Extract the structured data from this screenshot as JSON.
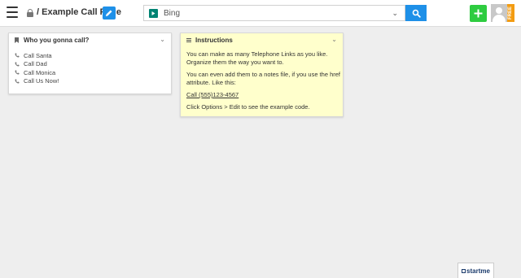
{
  "header": {
    "page_title": "/ Example Call Page",
    "search": {
      "engine_label": "Bing"
    },
    "free_badge": "FREE"
  },
  "widgets": {
    "calls": {
      "title": "Who you gonna call?",
      "items": [
        {
          "label": "Call Santa"
        },
        {
          "label": "Call Dad"
        },
        {
          "label": "Call Monica"
        },
        {
          "label": "Call Us Now!"
        }
      ]
    },
    "instructions": {
      "title": "Instructions",
      "paragraph1": "You can make as many Telephone Links as you like. Organize them the way you want to.",
      "paragraph2": "You can even add them to a notes file, if you use the href attribute. Like this:",
      "link_text": "Call (555)123-4567",
      "paragraph3": "Click Options > Edit to see the example code."
    }
  },
  "footer": {
    "brand": "startme"
  },
  "colors": {
    "accent": "#1e90e8",
    "add_button": "#2ecc40",
    "note_background": "#ffffcc",
    "badge": "#f39c12",
    "bing": "#008373"
  },
  "icons": [
    "menu-icon",
    "lock-icon",
    "pencil-icon",
    "bing-icon",
    "chevron-down-icon",
    "search-icon",
    "plus-icon",
    "avatar",
    "bookmark-icon",
    "notes-icon",
    "phone-icon"
  ]
}
